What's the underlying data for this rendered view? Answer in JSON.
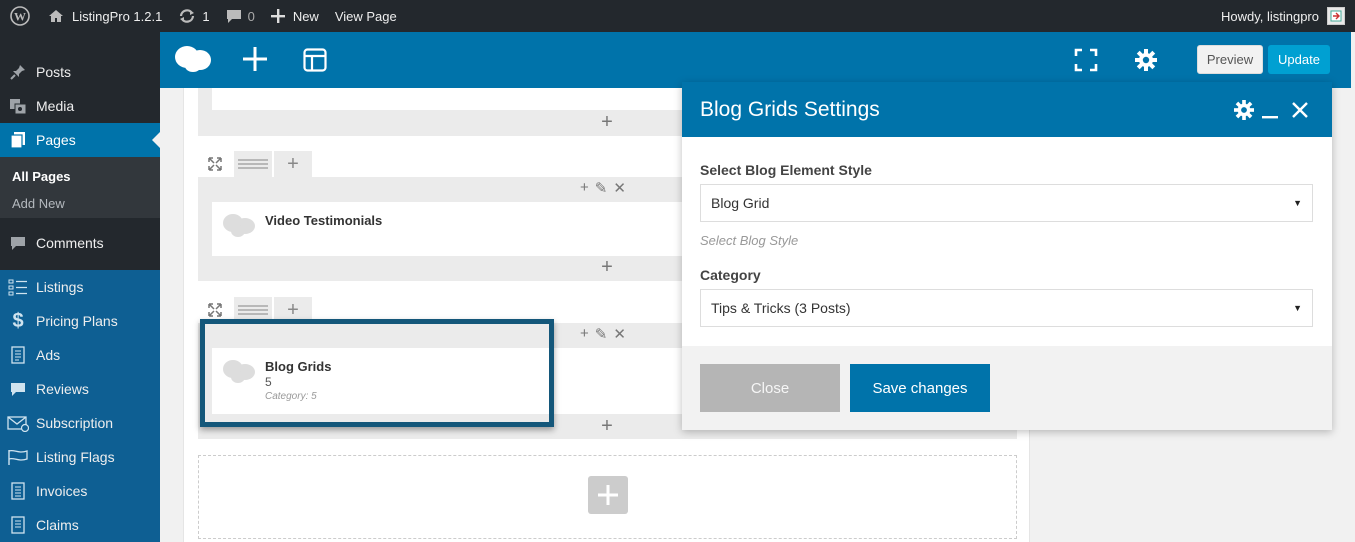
{
  "adminbar": {
    "site_name": "ListingPro 1.2.1",
    "updates_count": "1",
    "comments_count": "0",
    "new_label": "New",
    "view_page_label": "View Page",
    "howdy": "Howdy, listingpro"
  },
  "sidebar": {
    "items": [
      {
        "label": "Posts",
        "icon": "pin-icon"
      },
      {
        "label": "Media",
        "icon": "media-icon"
      },
      {
        "label": "Pages",
        "icon": "pages-icon"
      },
      {
        "label": "Comments",
        "icon": "comments-icon"
      },
      {
        "label": "Listings",
        "icon": "listings-icon"
      },
      {
        "label": "Pricing Plans",
        "icon": "dollar-icon"
      },
      {
        "label": "Ads",
        "icon": "ads-icon"
      },
      {
        "label": "Reviews",
        "icon": "reviews-icon"
      },
      {
        "label": "Subscription",
        "icon": "subscription-icon"
      },
      {
        "label": "Listing Flags",
        "icon": "flag-icon"
      },
      {
        "label": "Invoices",
        "icon": "invoices-icon"
      },
      {
        "label": "Claims",
        "icon": "claims-icon"
      }
    ],
    "submenu": {
      "all_pages": "All Pages",
      "add_new": "Add New"
    }
  },
  "toolbar": {
    "preview_label": "Preview",
    "update_label": "Update"
  },
  "canvas": {
    "element1_title": "Video Testimonials",
    "element2_title": "Blog Grids",
    "element2_value": "5",
    "element2_meta": "Category: 5"
  },
  "modal": {
    "title": "Blog Grids Settings",
    "style_label": "Select Blog Element Style",
    "style_value": "Blog Grid",
    "style_hint": "Select Blog Style",
    "category_label": "Category",
    "category_value": "Tips & Tricks (3 Posts)",
    "close_label": "Close",
    "save_label": "Save changes"
  },
  "colors": {
    "admin_bar": "#23282d",
    "accent_blue": "#0073aa",
    "sidebar_blue": "#0e5f93",
    "update_button": "#00a0d2"
  }
}
